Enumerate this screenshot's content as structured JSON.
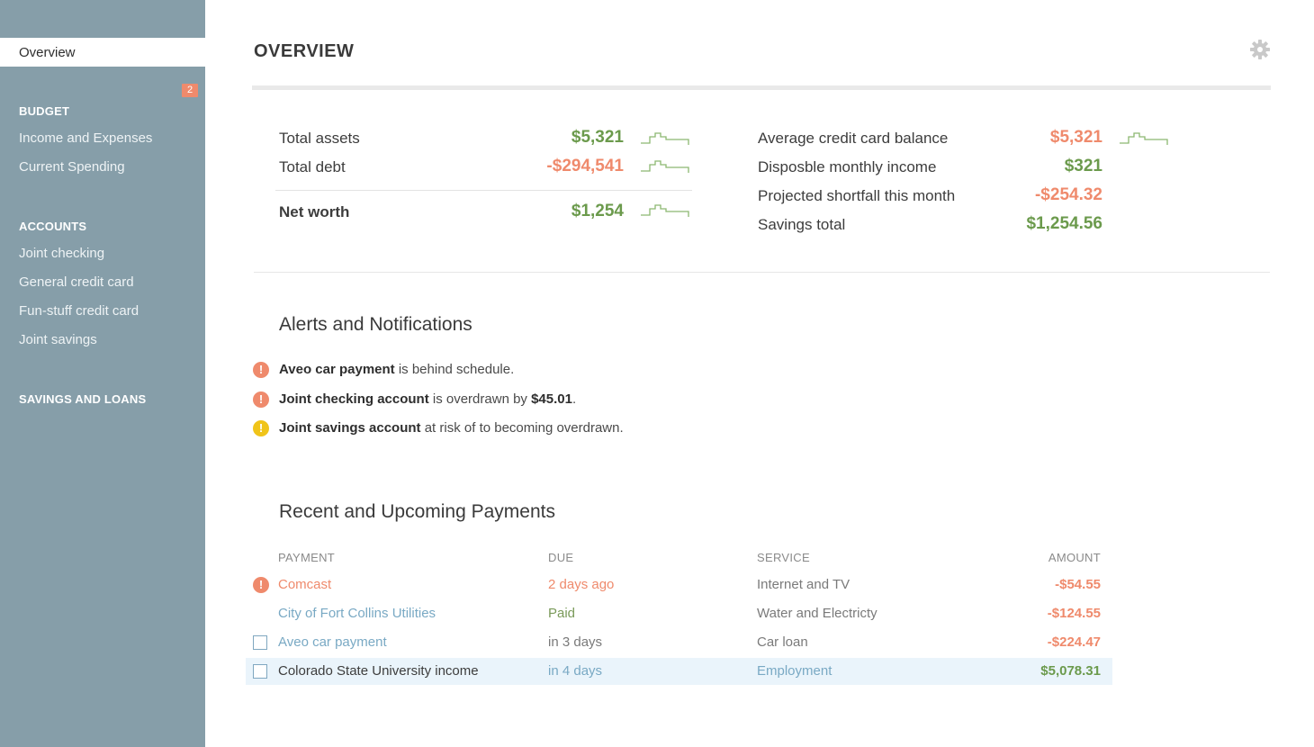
{
  "sidebar": {
    "active": {
      "label": "Overview",
      "badge": "2"
    },
    "sections": [
      {
        "title": "BUDGET",
        "items": [
          "Income and Expenses",
          "Current Spending"
        ]
      },
      {
        "title": "ACCOUNTS",
        "items": [
          "Joint checking",
          "General credit card",
          "Fun-stuff credit card",
          "Joint savings"
        ]
      },
      {
        "title": "SAVINGS AND LOANS",
        "items": []
      }
    ]
  },
  "header": {
    "title": "OVERVIEW",
    "settings_icon": "gear-icon"
  },
  "summary": {
    "left": [
      {
        "label": "Total assets",
        "value": "$5,321",
        "tone": "green"
      },
      {
        "label": "Total debt",
        "value": "-$294,541",
        "tone": "red"
      },
      {
        "label": "Net worth",
        "value": "$1,254",
        "tone": "green"
      }
    ],
    "right": [
      {
        "label": "Average credit card balance",
        "value": "$5,321",
        "tone": "red"
      },
      {
        "label": "Disposble monthly income",
        "value": "$321",
        "tone": "green"
      },
      {
        "label": "Projected shortfall this month",
        "value": "-$254.32",
        "tone": "red"
      },
      {
        "label": "Savings total",
        "value": "$1,254.56",
        "tone": "green"
      }
    ]
  },
  "alerts": {
    "title": "Alerts and Notifications",
    "items": [
      {
        "bold": "Aveo car payment",
        "text": " is behind schedule.",
        "level": "error"
      },
      {
        "bold": "Joint checking account",
        "text": " is overdrawn by ",
        "bold2": "$45.01",
        "tail": ".",
        "level": "error"
      },
      {
        "bold": "Joint savings account",
        "text": " at risk of to becoming overdrawn.",
        "level": "warning"
      }
    ]
  },
  "payments": {
    "title": "Recent and Upcoming Payments",
    "columns": [
      "PAYMENT",
      "DUE",
      "SERVICE",
      "AMOUNT"
    ],
    "rows": [
      {
        "payment": "Comcast",
        "due": "2 days ago",
        "service": "Internet and TV",
        "amount": "-$54.55",
        "marker": "alert"
      },
      {
        "payment": "City of Fort Collins Utilities",
        "due": "Paid",
        "service": "Water and Electricty",
        "amount": "-$124.55",
        "marker": "none"
      },
      {
        "payment": "Aveo car payment",
        "due": "in 3 days",
        "service": "Car loan",
        "amount": "-$224.47",
        "marker": "checkbox"
      },
      {
        "payment": "Colorado State University income",
        "due": "in 4 days",
        "service": "Employment",
        "amount": "$5,078.31",
        "marker": "checkbox"
      }
    ]
  },
  "colors": {
    "sidebar": "#869ea9",
    "green": "#6b9a4c",
    "red": "#ef8a6c",
    "blue": "#79a9c4",
    "warning": "#f0c419"
  }
}
